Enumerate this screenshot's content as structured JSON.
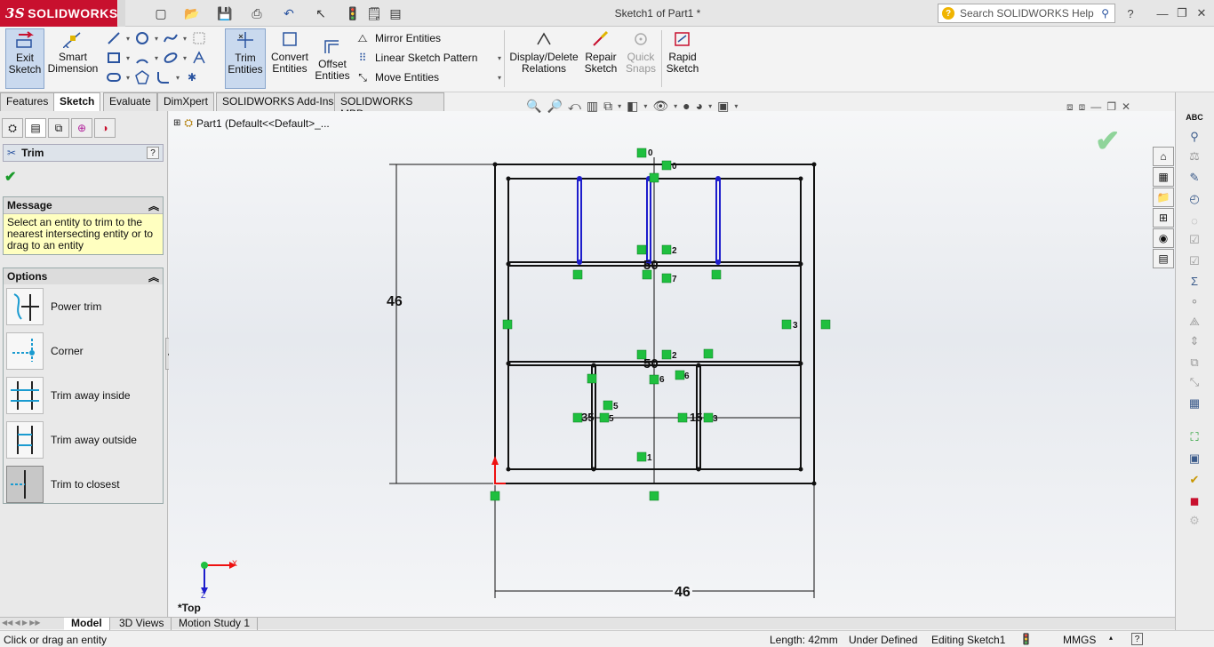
{
  "app": {
    "brand": "SOLIDWORKS",
    "doc_title": "Sketch1 of Part1 *"
  },
  "search": {
    "placeholder": "Search SOLIDWORKS Help"
  },
  "commands": {
    "exit_sketch": "Exit Sketch",
    "smart_dimension": "Smart Dimension",
    "trim_entities": "Trim Entities",
    "convert_entities": "Convert Entities",
    "offset_entities": "Offset Entities",
    "mirror_entities": "Mirror Entities",
    "linear_pattern": "Linear Sketch Pattern",
    "move_entities": "Move Entities",
    "display_relations": "Display/Delete Relations",
    "repair_sketch": "Repair Sketch",
    "quick_snaps": "Quick Snaps",
    "rapid_sketch": "Rapid Sketch"
  },
  "tabs": [
    "Features",
    "Sketch",
    "Evaluate",
    "DimXpert",
    "SOLIDWORKS Add-Ins",
    "SOLIDWORKS MBD"
  ],
  "active_tab": "Sketch",
  "tree": {
    "part": "Part1  (Default<<Default>_..."
  },
  "property_manager": {
    "title": "Trim",
    "help": "?",
    "message_header": "Message",
    "message": "Select an entity to trim to the nearest intersecting entity or to drag to an entity",
    "options_header": "Options",
    "options": [
      {
        "label": "Power trim",
        "selected": false
      },
      {
        "label": "Corner",
        "selected": false
      },
      {
        "label": "Trim away inside",
        "selected": false
      },
      {
        "label": "Trim away outside",
        "selected": false
      },
      {
        "label": "Trim to closest",
        "selected": true
      }
    ]
  },
  "sketch": {
    "dim_vertical": "46",
    "dim_horizontal": "46",
    "view_label": "*Top",
    "axis_x": "X",
    "axis_z": "Z",
    "relation_labels": [
      "0",
      "0",
      "2",
      "7",
      "3",
      "2",
      "6",
      "6",
      "5",
      "5",
      "3",
      "1",
      "50",
      "50",
      "35",
      "15"
    ]
  },
  "bottom_tabs": [
    "Model",
    "3D Views",
    "Motion Study 1"
  ],
  "active_bottom_tab": "Model",
  "status": {
    "hint": "Click or drag an entity",
    "length": "Length: 42mm",
    "defined": "Under Defined",
    "editing": "Editing Sketch1",
    "units": "MMGS",
    "help": "?"
  },
  "colors": {
    "accent_red": "#c8102e",
    "sketch_blue": "#1d1dcc",
    "relation_green": "#1fbf3f",
    "message_bg": "#ffffc0"
  }
}
